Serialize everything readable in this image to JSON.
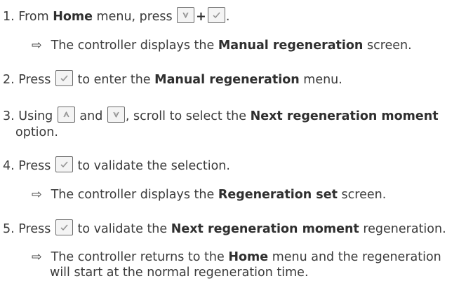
{
  "steps": {
    "s1": {
      "num": "1.",
      "a": "From ",
      "b": "Home",
      "c": " menu, press",
      "plus": "+",
      "end": "."
    },
    "r1": {
      "arrow": "⇨",
      "a": "The controller displays the ",
      "b": "Manual regeneration",
      "c": " screen."
    },
    "s2": {
      "num": "2.",
      "a": "Press",
      "b": " to enter the ",
      "c": "Manual regeneration",
      "d": " menu."
    },
    "s3": {
      "num": "3.",
      "a": "Using",
      "b": " and ",
      "c": ", scroll to select the ",
      "d": "Next regeneration moment",
      "e": "option."
    },
    "s4": {
      "num": "4.",
      "a": "Press",
      "b": " to validate the selection."
    },
    "r4": {
      "arrow": "⇨",
      "a": "The controller displays the ",
      "b": "Regeneration set",
      "c": " screen."
    },
    "s5": {
      "num": "5.",
      "a": "Press",
      "b": " to validate the ",
      "c": "Next regeneration moment",
      "d": " regeneration."
    },
    "r5": {
      "arrow": "⇨",
      "a": "The controller returns to the ",
      "b": "Home",
      "c": " menu and the regeneration",
      "d": "will start at the normal regeneration time."
    }
  },
  "icons": {
    "down": "down-arrow-key-icon",
    "check": "checkmark-key-icon",
    "up": "up-arrow-key-icon"
  }
}
